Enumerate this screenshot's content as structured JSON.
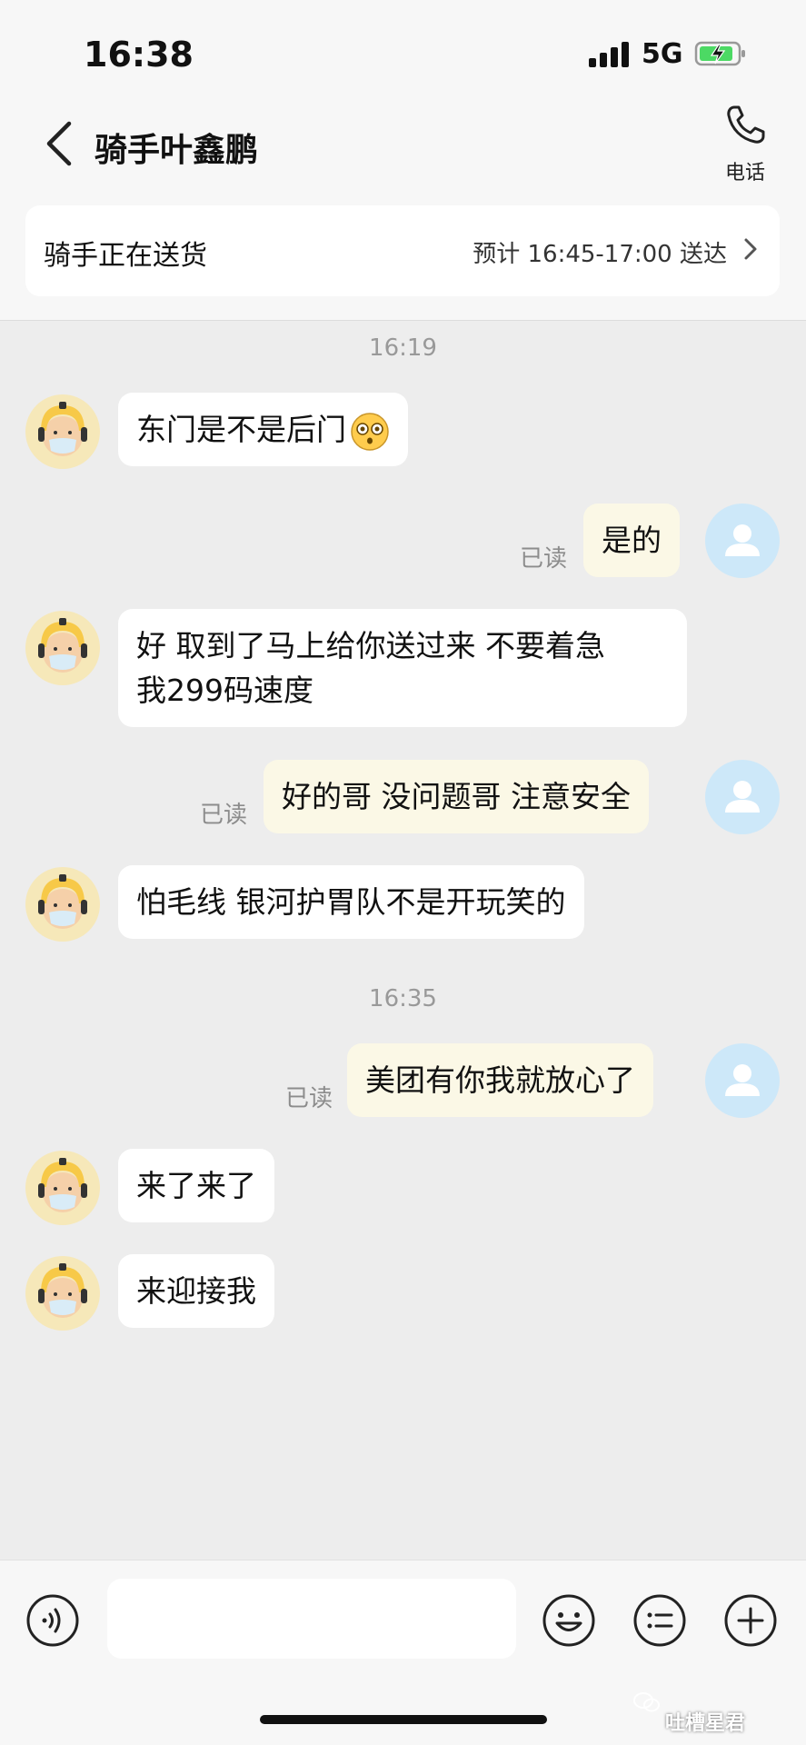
{
  "status_bar": {
    "time": "16:38",
    "network": "5G",
    "signal_icon": "signal-icon",
    "battery_icon": "battery-charging-icon"
  },
  "header": {
    "back_icon": "chevron-left-icon",
    "title": "骑手叶鑫鹏",
    "phone_icon": "phone-icon",
    "phone_label": "电话"
  },
  "delivery": {
    "status": "骑手正在送货",
    "eta": "预计 16:45-17:00 送达",
    "chevron_icon": "chevron-right-icon"
  },
  "timestamps": [
    "16:19",
    "16:35"
  ],
  "read_label": "已读",
  "messages": [
    {
      "from": "rider",
      "text": "东门是不是后门",
      "emoji": "flushed-face-emoji"
    },
    {
      "from": "me",
      "text": "是的",
      "read": true
    },
    {
      "from": "rider",
      "lines": [
        "好 取到了马上给你送过来 不要着急",
        "我299码速度"
      ]
    },
    {
      "from": "me",
      "text": "好的哥 没问题哥 注意安全",
      "read": true
    },
    {
      "from": "rider",
      "text": "怕毛线 银河护胃队不是开玩笑的"
    },
    {
      "from": "me",
      "text": "美团有你我就放心了",
      "read": true
    },
    {
      "from": "rider",
      "text": "来了来了"
    },
    {
      "from": "rider",
      "text": "来迎接我"
    }
  ],
  "input_bar": {
    "voice_icon": "voice-icon",
    "emoji_icon": "smile-emoji-icon",
    "quick_reply_icon": "list-icon",
    "plus_icon": "plus-icon"
  },
  "watermark": {
    "icon": "wechat-icon",
    "text": "吐槽星君"
  },
  "colors": {
    "background": "#ededed",
    "my_bubble": "#fbf8e6",
    "rider_bubble": "#ffffff",
    "my_avatar": "#cde8f9",
    "rider_avatar": "#f6e8b9"
  }
}
